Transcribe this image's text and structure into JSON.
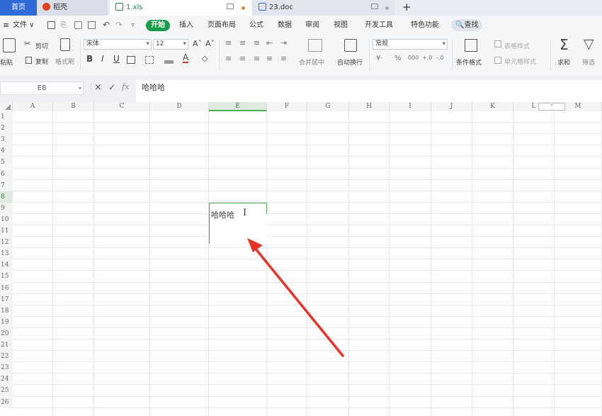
{
  "tabs": {
    "home": "首页",
    "daoke": "稻壳",
    "xls": "1.xls",
    "doc": "23.doc"
  },
  "menu": {
    "file": "文件",
    "start": "开始",
    "insert": "插入",
    "page_layout": "页面布局",
    "formula": "公式",
    "data": "数据",
    "review": "审阅",
    "view": "视图",
    "developer": "开发工具",
    "special": "特色功能",
    "search": "查找"
  },
  "toolbar": {
    "paste": "粘贴",
    "cut": "剪切",
    "copy": "复制",
    "format_painter": "格式刷",
    "font_name": "宋体",
    "font_size": "12",
    "merge_center": "合并居中",
    "wrap_text": "自动换行",
    "number_format": "常规",
    "conditional_format": "条件格式",
    "table_style": "表格样式",
    "cell_style": "单元格样式",
    "sum": "求和",
    "filter": "筛选"
  },
  "formula_bar": {
    "cell_ref": "E8",
    "content": "哈哈哈"
  },
  "sheet": {
    "columns": [
      "A",
      "B",
      "C",
      "D",
      "E",
      "F",
      "G",
      "H",
      "I",
      "J",
      "K",
      "L",
      "M"
    ],
    "rows": [
      "1",
      "2",
      "3",
      "4",
      "5",
      "6",
      "7",
      "8",
      "9",
      "10",
      "11",
      "12",
      "13",
      "14",
      "15",
      "16",
      "17",
      "18",
      "19",
      "20",
      "21",
      "22",
      "23",
      "24",
      "25",
      "26"
    ],
    "selected_column": "E",
    "selected_row": "8",
    "cell_value": "哈哈哈"
  },
  "colors": {
    "accent_green": "#1a9b4b",
    "home_tab_blue": "#2e6bd6",
    "arrow_red": "#e8332b",
    "selection_green": "#4caf50"
  }
}
